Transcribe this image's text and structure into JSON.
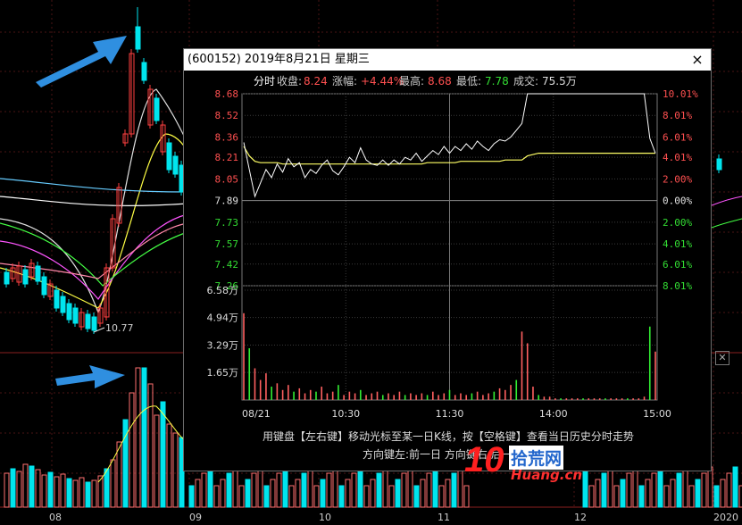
{
  "background": {
    "month_labels": [
      "08",
      "09",
      "10",
      "11",
      "12",
      "2020"
    ],
    "low_marker": "10.77"
  },
  "dialog": {
    "title": "(600152) 2019年8月21日 星期三",
    "close_glyph": "×",
    "header": {
      "fenshi": "分时",
      "close_label": "收盘:",
      "close_value": "8.24",
      "change_label": "涨幅:",
      "change_value": "+4.44%",
      "high_label": "最高:",
      "high_value": "8.68",
      "low_label": "最低:",
      "low_value": "7.78",
      "volume_label": "成交:",
      "volume_value": "75.5万"
    },
    "hint_line1": "用键盘【左右键】移动光标至某一日K线，按【空格键】查看当日历史分时走势",
    "hint_line2": "方向键左:前一日    方向键右:后一日"
  },
  "watermark": {
    "number": "10",
    "text_cn": "拾荒网",
    "text_en": "Huang.cn"
  },
  "colors": {
    "up": "#ff5050",
    "down": "#33dd33",
    "neutral": "#e0e0e0",
    "price_line": "#ffffff",
    "avg_line": "#ffff66",
    "volume": "#ff6060",
    "volume_down": "#33ee33",
    "arrow": "#2f8fe0",
    "cyan_candle": "#00e5ee"
  },
  "chart_data": {
    "type": "line",
    "title": "",
    "prev_close": 7.89,
    "price_ticks": [
      8.68,
      8.52,
      8.36,
      8.21,
      8.05,
      7.89,
      7.73,
      7.57,
      7.42,
      7.26
    ],
    "pct_ticks": [
      "10.01%",
      "8.01%",
      "6.01%",
      "4.01%",
      "2.00%",
      "0.00%",
      "2.00%",
      "4.01%",
      "6.01%",
      "8.01%"
    ],
    "ylim": [
      7.26,
      8.68
    ],
    "volume_ticks": [
      "6.58万",
      "4.94万",
      "3.29万",
      "1.65万"
    ],
    "volume_ylim": [
      0,
      6.58
    ],
    "x_ticks": [
      "08/21",
      "10:30",
      "11:30",
      "14:00",
      "15:00"
    ],
    "series": [
      {
        "values": [
          8.32,
          8.12,
          7.92,
          8.02,
          8.12,
          8.06,
          8.16,
          8.1,
          8.2,
          8.14,
          8.17,
          8.06,
          8.12,
          8.09,
          8.15,
          8.19,
          8.11,
          8.08,
          8.14,
          8.21,
          8.17,
          8.28,
          8.19,
          8.16,
          8.15,
          8.19,
          8.15,
          8.19,
          8.16,
          8.21,
          8.19,
          8.24,
          8.18,
          8.22,
          8.26,
          8.23,
          8.29,
          8.24,
          8.29,
          8.26,
          8.31,
          8.27,
          8.33,
          8.29,
          8.26,
          8.31,
          8.34,
          8.33,
          8.36,
          8.41,
          8.46,
          8.68,
          8.68,
          8.68,
          8.68,
          8.68,
          8.68,
          8.68,
          8.68,
          8.68,
          8.68,
          8.68,
          8.68,
          8.68,
          8.68,
          8.68,
          8.68,
          8.68,
          8.68,
          8.68,
          8.68,
          8.68,
          8.68,
          8.35,
          8.24
        ]
      },
      {
        "values": [
          8.29,
          8.22,
          8.18,
          8.17,
          8.17,
          8.17,
          8.17,
          8.16,
          8.16,
          8.16,
          8.16,
          8.16,
          8.16,
          8.16,
          8.16,
          8.16,
          8.16,
          8.16,
          8.16,
          8.16,
          8.16,
          8.16,
          8.16,
          8.16,
          8.16,
          8.16,
          8.16,
          8.16,
          8.16,
          8.16,
          8.16,
          8.16,
          8.16,
          8.17,
          8.17,
          8.17,
          8.17,
          8.17,
          8.17,
          8.18,
          8.18,
          8.18,
          8.18,
          8.18,
          8.18,
          8.18,
          8.18,
          8.19,
          8.19,
          8.19,
          8.19,
          8.22,
          8.23,
          8.24,
          8.24,
          8.24,
          8.24,
          8.24,
          8.24,
          8.24,
          8.24,
          8.24,
          8.24,
          8.24,
          8.24,
          8.24,
          8.24,
          8.24,
          8.24,
          8.24,
          8.24,
          8.24,
          8.24,
          8.24,
          8.24
        ]
      }
    ],
    "volume": [
      5.2,
      3.1,
      1.9,
      1.2,
      1.6,
      0.8,
      1.0,
      0.6,
      0.9,
      0.5,
      0.7,
      0.4,
      0.6,
      0.5,
      0.8,
      0.4,
      0.5,
      0.9,
      0.3,
      0.5,
      0.4,
      0.6,
      0.3,
      0.4,
      0.5,
      0.3,
      0.4,
      0.3,
      0.5,
      0.3,
      0.4,
      0.3,
      0.4,
      0.3,
      0.5,
      0.3,
      0.4,
      0.6,
      0.3,
      0.4,
      0.3,
      0.4,
      0.5,
      0.3,
      0.4,
      0.5,
      0.7,
      0.6,
      0.9,
      1.2,
      4.1,
      3.4,
      0.8,
      0.3,
      0.2,
      0.2,
      0.1,
      0.1,
      0.1,
      0.1,
      0.1,
      0.1,
      0.1,
      0.1,
      0.1,
      0.1,
      0.1,
      0.1,
      0.1,
      0.1,
      0.1,
      0.1,
      0.2,
      4.4,
      2.9
    ]
  }
}
